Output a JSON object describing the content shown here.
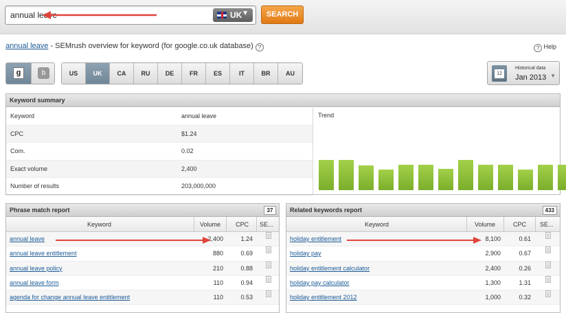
{
  "search": {
    "query": "annual leave",
    "database": "UK",
    "button": "SEARCH"
  },
  "header": {
    "keyword_link": "annual leave",
    "subtitle": " - SEMrush overview for keyword (for google.co.uk database)",
    "help": "Help"
  },
  "engines": [
    "g",
    "b"
  ],
  "databases": [
    "US",
    "UK",
    "CA",
    "RU",
    "DE",
    "FR",
    "ES",
    "IT",
    "BR",
    "AU"
  ],
  "active_database": "UK",
  "historical": {
    "caption": "Historical data",
    "value": "Jan 2013",
    "calendar_day": "12"
  },
  "summary": {
    "title": "Keyword summary",
    "trend_label": "Trend",
    "rows": [
      {
        "label": "Keyword",
        "value": "annual leave"
      },
      {
        "label": "CPC",
        "value": "$1.24"
      },
      {
        "label": "Com.",
        "value": "0.02"
      },
      {
        "label": "Exact volume",
        "value": "2,400"
      },
      {
        "label": "Number of results",
        "value": "203,000,000"
      }
    ],
    "trend_values": [
      0.78,
      0.78,
      0.64,
      0.53,
      0.66,
      0.66,
      0.55,
      0.78,
      0.66,
      0.66,
      0.53,
      0.66,
      0.66
    ]
  },
  "phrase": {
    "title": "Phrase match report",
    "count": "37",
    "columns": [
      "Keyword",
      "Volume",
      "CPC",
      "SE..."
    ],
    "rows": [
      {
        "keyword": "annual leave",
        "volume": "2,400",
        "cpc": "1.24"
      },
      {
        "keyword": "annual leave entitlement",
        "volume": "880",
        "cpc": "0.69"
      },
      {
        "keyword": "annual leave policy",
        "volume": "210",
        "cpc": "0.88"
      },
      {
        "keyword": "annual leave form",
        "volume": "110",
        "cpc": "0.94"
      },
      {
        "keyword": "agenda for change annual leave entitlement",
        "volume": "110",
        "cpc": "0.53"
      }
    ]
  },
  "related": {
    "title": "Related keywords report",
    "count": "433",
    "columns": [
      "Keyword",
      "Volume",
      "CPC",
      "SE..."
    ],
    "rows": [
      {
        "keyword": "holiday entitlement",
        "volume": "8,100",
        "cpc": "0.61"
      },
      {
        "keyword": "holiday pay",
        "volume": "2,900",
        "cpc": "0.67"
      },
      {
        "keyword": "holiday entitlement calculator",
        "volume": "2,400",
        "cpc": "0.26"
      },
      {
        "keyword": "holiday pay calculator",
        "volume": "1,300",
        "cpc": "1.31"
      },
      {
        "keyword": "holiday entitlement 2012",
        "volume": "1,000",
        "cpc": "0.32"
      }
    ]
  },
  "colors": {
    "accent_orange": "#e88a26",
    "link_blue": "#1a5a96",
    "trend_green": "#8cc63f",
    "annotation_red": "#e0443a"
  }
}
